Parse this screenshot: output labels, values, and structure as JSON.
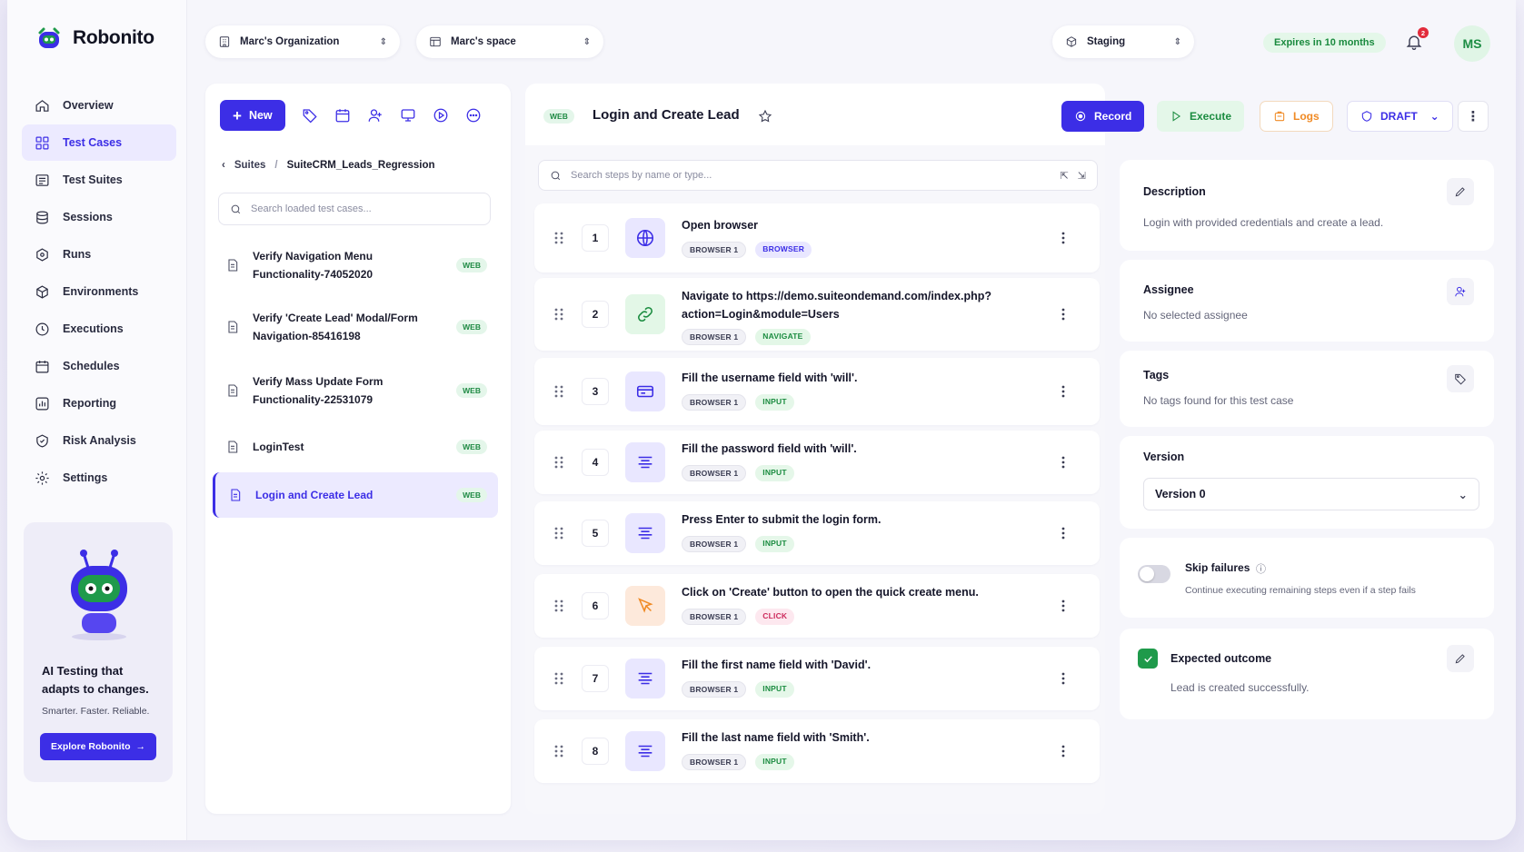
{
  "brand": {
    "name": "Robonito"
  },
  "nav": [
    {
      "label": "Overview",
      "icon": "home-icon"
    },
    {
      "label": "Test Cases",
      "icon": "grid-icon",
      "active": true
    },
    {
      "label": "Test Suites",
      "icon": "suites-icon"
    },
    {
      "label": "Sessions",
      "icon": "database-icon"
    },
    {
      "label": "Runs",
      "icon": "box-icon"
    },
    {
      "label": "Environments",
      "icon": "cube-icon"
    },
    {
      "label": "Executions",
      "icon": "clock-icon"
    },
    {
      "label": "Schedules",
      "icon": "calendar-icon"
    },
    {
      "label": "Reporting",
      "icon": "chart-icon"
    },
    {
      "label": "Risk Analysis",
      "icon": "shield-icon"
    },
    {
      "label": "Settings",
      "icon": "gear-icon"
    }
  ],
  "promo": {
    "title": "AI Testing that adapts to changes.",
    "subtitle": "Smarter. Faster. Reliable.",
    "button": "Explore Robonito"
  },
  "topbar": {
    "organization": "Marc's Organization",
    "space": "Marc's space",
    "environment": "Staging",
    "expires": "Expires in 10 months",
    "notifications": "2",
    "avatar": "MS"
  },
  "left": {
    "new_label": "New",
    "breadcrumb_root": "Suites",
    "breadcrumb_separator": "/",
    "breadcrumb_current": "SuiteCRM_Leads_Regression",
    "search_placeholder": "Search loaded test cases...",
    "cases": [
      {
        "name": "Verify Navigation Menu Functionality-74052020",
        "badge": "WEB"
      },
      {
        "name": "Verify 'Create Lead' Modal/Form Navigation-85416198",
        "badge": "WEB"
      },
      {
        "name": "Verify Mass Update Form Functionality-22531079",
        "badge": "WEB"
      },
      {
        "name": "LoginTest",
        "badge": "WEB"
      },
      {
        "name": "Login and Create Lead",
        "badge": "WEB",
        "active": true
      }
    ]
  },
  "detail": {
    "badge": "WEB",
    "title": "Login and Create Lead",
    "record": "Record",
    "execute": "Execute",
    "logs": "Logs",
    "status": "DRAFT",
    "search_placeholder": "Search steps by name or type...",
    "steps": [
      {
        "n": "1",
        "text": "Open browser",
        "tags": [
          "BROWSER 1",
          "BROWSER"
        ],
        "kind": "browser"
      },
      {
        "n": "2",
        "text": "Navigate to https://demo.suiteondemand.com/index.php?action=Login&module=Users",
        "tags": [
          "BROWSER 1",
          "NAVIGATE"
        ],
        "kind": "navigate"
      },
      {
        "n": "3",
        "text": "Fill the username field with 'will'.",
        "tags": [
          "BROWSER 1",
          "INPUT"
        ],
        "kind": "input-field"
      },
      {
        "n": "4",
        "text": "Fill the password field with 'will'.",
        "tags": [
          "BROWSER 1",
          "INPUT"
        ],
        "kind": "input"
      },
      {
        "n": "5",
        "text": "Press Enter to submit the login form.",
        "tags": [
          "BROWSER 1",
          "INPUT"
        ],
        "kind": "input"
      },
      {
        "n": "6",
        "text": "Click on 'Create' button to open the quick create menu.",
        "tags": [
          "BROWSER 1",
          "CLICK"
        ],
        "kind": "click"
      },
      {
        "n": "7",
        "text": "Fill the first name field with 'David'.",
        "tags": [
          "BROWSER 1",
          "INPUT"
        ],
        "kind": "input"
      },
      {
        "n": "8",
        "text": "Fill the last name field with 'Smith'.",
        "tags": [
          "BROWSER 1",
          "INPUT"
        ],
        "kind": "input"
      }
    ]
  },
  "side": {
    "description_title": "Description",
    "description_text": "Login with provided credentials and create a lead.",
    "assignee_title": "Assignee",
    "assignee_text": "No selected assignee",
    "tags_title": "Tags",
    "tags_text": "No tags found for this test case",
    "version_title": "Version",
    "version_value": "Version 0",
    "skip_title": "Skip failures",
    "skip_text": "Continue executing remaining steps even if a step fails",
    "outcome_title": "Expected outcome",
    "outcome_text": "Lead is created successfully."
  },
  "colors": {
    "accent": "#3c2ee6",
    "success": "#1f9a4b",
    "warning": "#f08a24",
    "danger": "#e22b3b"
  }
}
